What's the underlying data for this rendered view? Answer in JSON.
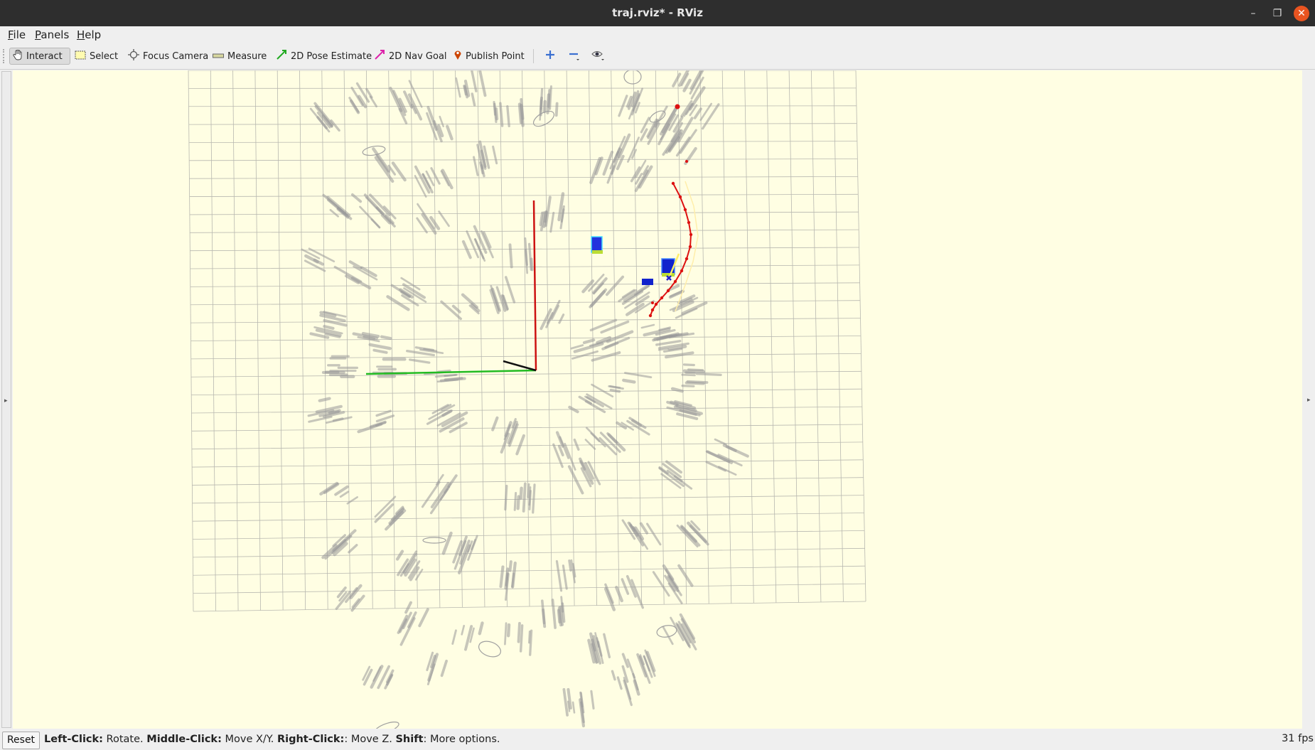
{
  "window": {
    "title": "traj.rviz* - RViz",
    "minimize_glyph": "–",
    "maximize_glyph": "❐",
    "close_glyph": "✕",
    "close_color": "#e95420"
  },
  "menubar": {
    "items": [
      {
        "label": "File",
        "mnemonic": "F",
        "rest": "ile"
      },
      {
        "label": "Panels",
        "mnemonic": "P",
        "rest": "anels"
      },
      {
        "label": "Help",
        "mnemonic": "H",
        "rest": "elp"
      }
    ]
  },
  "toolbar": {
    "interact": "Interact",
    "select": "Select",
    "focus_camera": "Focus Camera",
    "measure": "Measure",
    "pose_estimate": "2D Pose Estimate",
    "nav_goal": "2D Nav Goal",
    "publish_point": "Publish Point",
    "icons": [
      "hand-icon",
      "select-box-icon",
      "crosshair-icon",
      "ruler-icon",
      "green-arrow-icon",
      "magenta-arrow-icon",
      "map-pin-icon",
      "plus-icon",
      "minus-icon",
      "eye-icon"
    ]
  },
  "viewport": {
    "background": "#fffee3",
    "grid_color": "#b8b8b0",
    "axis_x_color": "#cc1111",
    "axis_y_color": "#22bb22",
    "trajectory_color": "#dd1111"
  },
  "statusbar": {
    "reset": "Reset",
    "hint_parts": [
      {
        "bold": "Left-Click:",
        "text": " Rotate. "
      },
      {
        "bold": "Middle-Click:",
        "text": " Move X/Y. "
      },
      {
        "bold": "Right-Click:",
        "text": ": Move Z. "
      },
      {
        "bold": "Shift",
        "text": ": More options."
      }
    ],
    "fps": "31 fps"
  }
}
